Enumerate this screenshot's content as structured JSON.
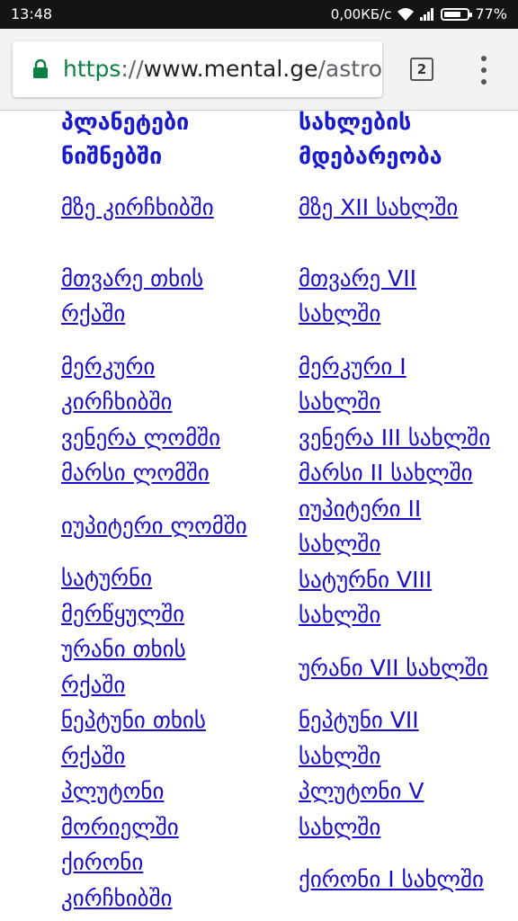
{
  "status_bar": {
    "time": "13:48",
    "network_speed": "0,00КБ/с",
    "battery": "77%",
    "battery_level": 0.77
  },
  "browser": {
    "url_scheme": "https",
    "url_separator": "://",
    "url_host": "www.mental.ge",
    "url_path": "/astro/c",
    "tab_count": "2",
    "colors": {
      "scheme_green": "#0b8043",
      "link_blue": "#1a0dcc"
    }
  },
  "page": {
    "left_header": "პლანეტები ნიშნებში",
    "right_header": "სახლების მდებარეობა",
    "left_links": [
      "მზე კირჩხიბში",
      "მთვარე თხის რქაში",
      "მერკური კირჩხიბში",
      "ვენერა ლომში",
      "მარსი ლომში",
      "იუპიტერი ლომში",
      "სატურნი მერწყულში",
      "ურანი თხის რქაში",
      "ნეპტუნი თხის რქაში",
      "პლუტონი მორიელში",
      "ქირონი კირჩხიბში"
    ],
    "right_links": [
      "მზე XII სახლში",
      "მთვარე VII სახლში",
      "მერკური I სახლში",
      "ვენერა III სახლში",
      "მარსი II სახლში",
      "იუპიტერი II სახლში",
      "სატურნი VIII სახლში",
      "ურანი VII სახლში",
      "ნეპტუნი VII სახლში",
      "პლუტონი V სახლში",
      "ქირონი I სახლში"
    ]
  }
}
